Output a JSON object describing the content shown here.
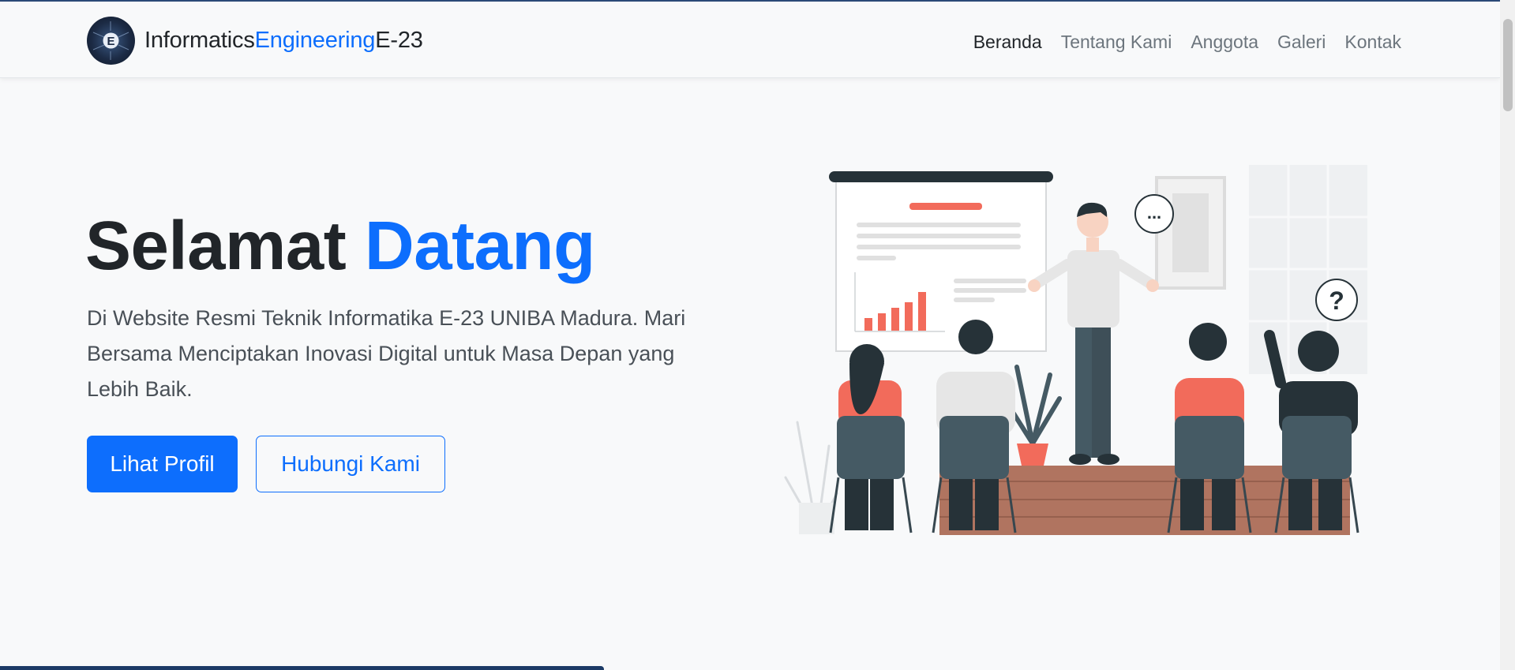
{
  "brand": {
    "part1": "Informatics",
    "part2": "Engineering",
    "part3": "E-23"
  },
  "nav": {
    "items": [
      "Beranda",
      "Tentang Kami",
      "Anggota",
      "Galeri",
      "Kontak"
    ]
  },
  "hero": {
    "title_part1": "Selamat",
    "title_part2": "Datang",
    "subtitle": "Di Website Resmi Teknik Informatika E-23 UNIBA Madura. Mari Bersama Menciptakan Inovasi Digital untuk Masa Depan yang Lebih Baik.",
    "primary_button": "Lihat Profil",
    "secondary_button": "Hubungi Kami"
  },
  "illustration": {
    "speech_bubble_1": "...",
    "speech_bubble_2": "?"
  },
  "colors": {
    "accent": "#0d6efd",
    "dark": "#212529",
    "coral": "#f26b5b",
    "slate": "#455a64"
  }
}
